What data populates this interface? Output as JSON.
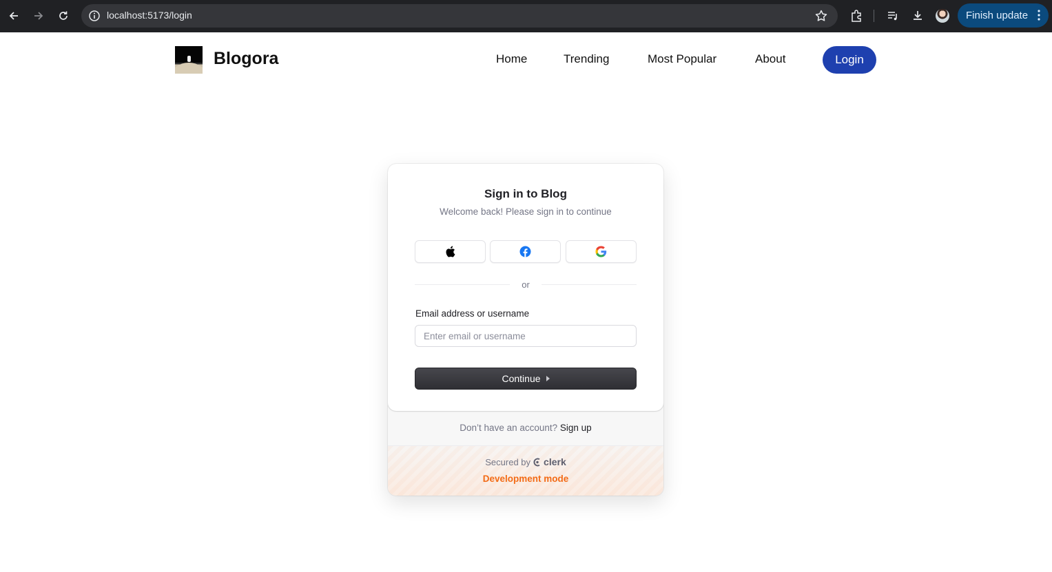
{
  "browser": {
    "url": "localhost:5173/login",
    "update_label": "Finish update",
    "icons": [
      "back-icon",
      "forward-icon",
      "reload-icon",
      "info-icon",
      "star-icon",
      "extensions-icon",
      "media-icon",
      "download-icon",
      "profile-avatar",
      "menu-dots-icon"
    ]
  },
  "header": {
    "brand": "Blogora",
    "nav": [
      "Home",
      "Trending",
      "Most Popular",
      "About"
    ],
    "login_label": "Login",
    "accent": "#1e40af"
  },
  "signin": {
    "title": "Sign in to Blog",
    "subtitle": "Welcome back! Please sign in to continue",
    "social_providers": [
      "apple-icon",
      "facebook-icon",
      "google-icon"
    ],
    "divider_text": "or",
    "email_label": "Email address or username",
    "email_placeholder": "Enter email or username",
    "email_value": "",
    "continue_label": "Continue",
    "signup_prompt": "Don’t have an account?",
    "signup_link": "Sign up",
    "secured_by": "Secured by",
    "clerk_brand": "clerk",
    "dev_mode": "Development mode",
    "dev_color": "#f36b16"
  }
}
